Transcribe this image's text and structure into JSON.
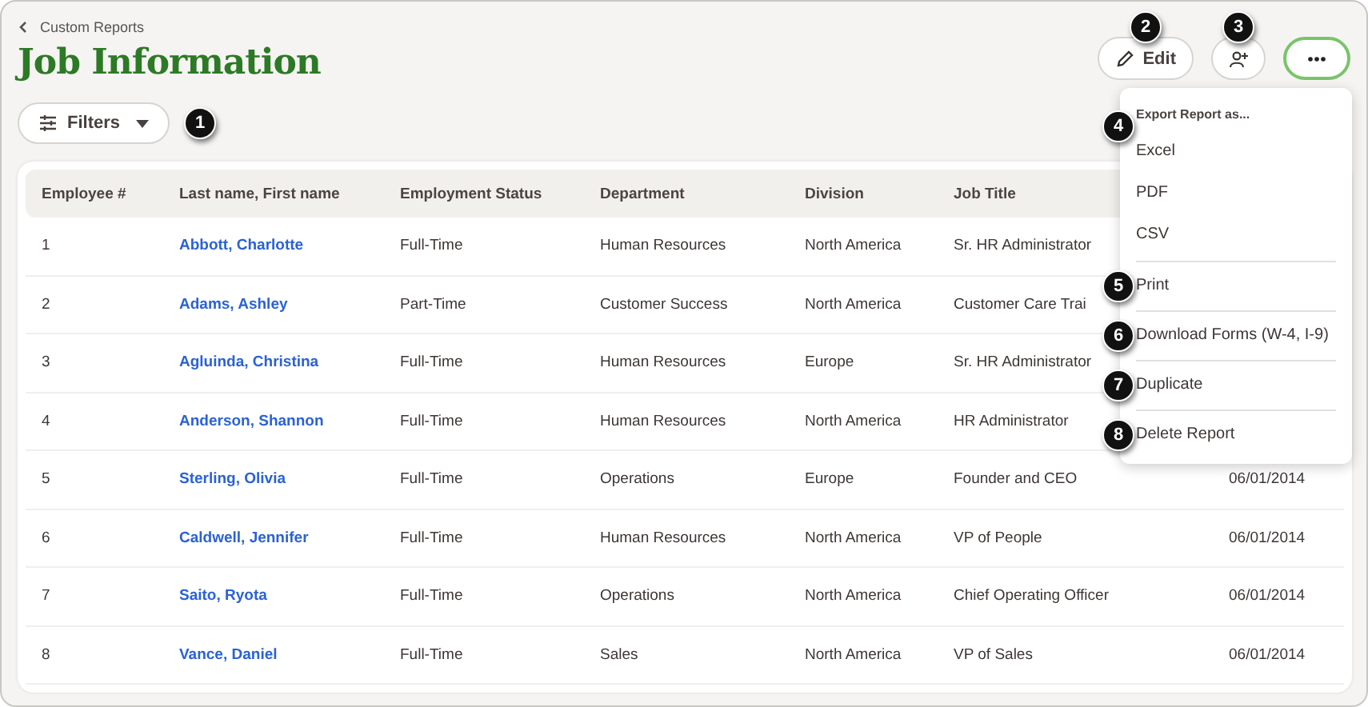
{
  "breadcrumb": {
    "label": "Custom Reports"
  },
  "title": "Job Information",
  "toolbar": {
    "filters": {
      "label": "Filters",
      "callout": "1"
    },
    "edit": {
      "label": "Edit",
      "callout": "2"
    },
    "add_user": {
      "callout": "3"
    },
    "more": {
      "selected": true
    }
  },
  "menu": {
    "header": "Export Report as...",
    "header_callout": "4",
    "items": [
      {
        "label": "Excel",
        "divider_before": false
      },
      {
        "label": "PDF",
        "divider_before": false
      },
      {
        "label": "CSV",
        "divider_before": false
      },
      {
        "label": "Print",
        "divider_before": true,
        "callout": "5"
      },
      {
        "label": "Download Forms (W-4, I-9)",
        "divider_before": true,
        "callout": "6"
      },
      {
        "label": "Duplicate",
        "divider_before": true,
        "callout": "7"
      },
      {
        "label": "Delete Report",
        "divider_before": true,
        "callout": "8"
      }
    ]
  },
  "table": {
    "columns": [
      "Employee #",
      "Last name, First name",
      "Employment Status",
      "Department",
      "Division",
      "Job Title"
    ],
    "rows": [
      {
        "number": "1",
        "name": "Abbott, Charlotte",
        "status": "Full-Time",
        "department": "Human Resources",
        "division": "North America",
        "job_title": "Sr. HR Administrator"
      },
      {
        "number": "2",
        "name": "Adams, Ashley",
        "status": "Part-Time",
        "department": "Customer Success",
        "division": "North America",
        "job_title": "Customer Care Trai"
      },
      {
        "number": "3",
        "name": "Agluinda, Christina",
        "status": "Full-Time",
        "department": "Human Resources",
        "division": "Europe",
        "job_title": "Sr. HR Administrator"
      },
      {
        "number": "4",
        "name": "Anderson, Shannon",
        "status": "Full-Time",
        "department": "Human Resources",
        "division": "North America",
        "job_title": "HR Administrator"
      },
      {
        "number": "5",
        "name": "Sterling, Olivia",
        "status": "Full-Time",
        "department": "Operations",
        "division": "Europe",
        "job_title": "Founder and CEO",
        "column_7": "06/01/2014"
      },
      {
        "number": "6",
        "name": "Caldwell, Jennifer",
        "status": "Full-Time",
        "department": "Human Resources",
        "division": "North America",
        "job_title": "VP of People",
        "column_7": "06/01/2014"
      },
      {
        "number": "7",
        "name": "Saito, Ryota",
        "status": "Full-Time",
        "department": "Operations",
        "division": "North America",
        "job_title": "Chief Operating Officer",
        "column_7": "06/01/2014"
      },
      {
        "number": "8",
        "name": "Vance, Daniel",
        "status": "Full-Time",
        "department": "Sales",
        "division": "North America",
        "job_title": "VP of Sales",
        "column_7": "06/01/2014"
      }
    ]
  }
}
